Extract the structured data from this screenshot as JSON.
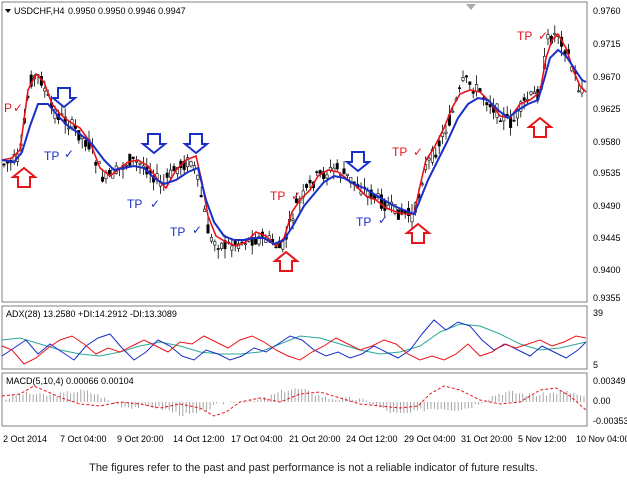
{
  "main_chart": {
    "title": "USDCHF,H4",
    "ohlc": "0.9950 0.9950 0.9946 0.9947",
    "price_ticks": [
      "0.9760",
      "0.9715",
      "0.9670",
      "0.9625",
      "0.9580",
      "0.9535",
      "0.9490",
      "0.9445",
      "0.9400",
      "0.9355"
    ]
  },
  "adx_panel": {
    "label": "ADX(28) 13.2580 +DI:14.2912 -DI:13.3089",
    "ticks": [
      "39",
      "5"
    ]
  },
  "macd_panel": {
    "label": "MACD(5,10,4) 0.00066 0.00104",
    "ticks": [
      "0.00349",
      "0.00",
      "-0.00353"
    ]
  },
  "time_axis": [
    "2 Oct 2014",
    "7 Oct 04:00",
    "9 Oct 20:00",
    "14 Oct 12:00",
    "17 Oct 04:00",
    "21 Oct 20:00",
    "24 Oct 12:00",
    "29 Oct 04:00",
    "31 Oct 20:00",
    "5 Nov 12:00",
    "10 Nov 04:00"
  ],
  "markers": {
    "tp_label": "TP",
    "check_glyph": "✓",
    "red_p_label": "P"
  },
  "colors": {
    "buy_signal": "#e8141c",
    "sell_signal": "#1a2fc8",
    "fast_ma": "#e8141c",
    "slow_ma": "#1a2fc8",
    "candles": "#000000",
    "adx_line": "#2aa89a",
    "plus_di": "#1a2fc8",
    "minus_di": "#e8141c",
    "macd_signal": "#e8141c"
  },
  "disclaimer": "The figures refer to the past and past performance is not a reliable indicator of future results."
}
